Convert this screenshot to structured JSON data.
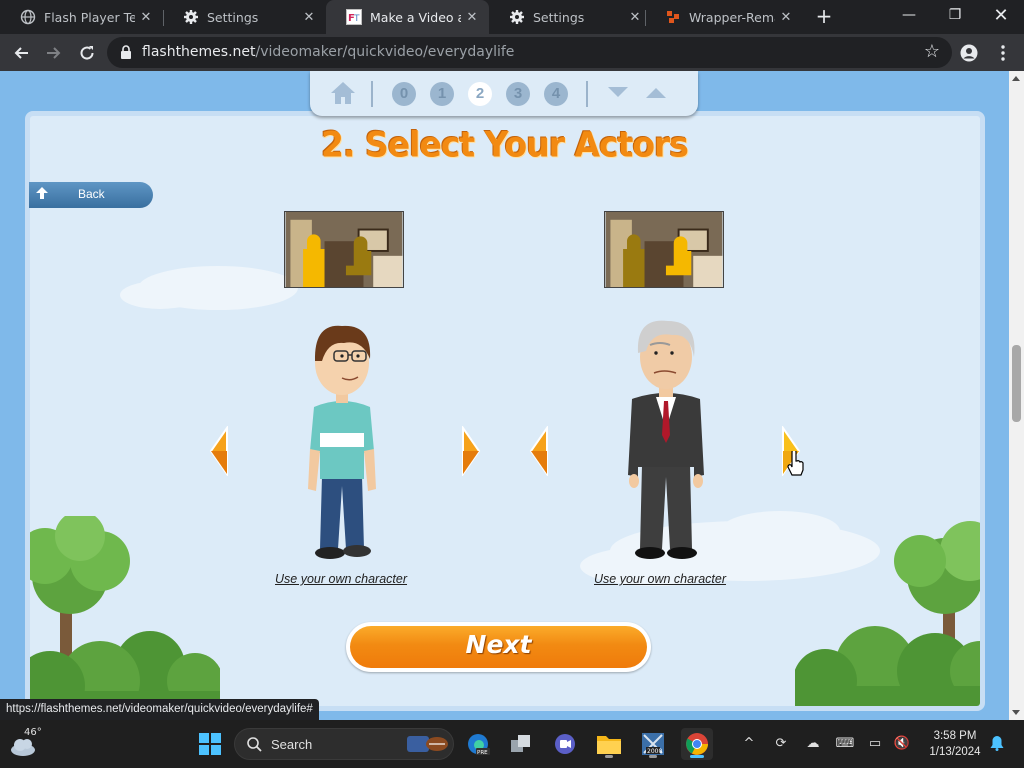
{
  "browser": {
    "tabs": [
      {
        "title": "Flash Player Test",
        "icon": "globe-icon"
      },
      {
        "title": "Settings",
        "icon": "gear-icon"
      },
      {
        "title": "Make a Video abo",
        "icon": "flashthemes-icon",
        "active": true
      },
      {
        "title": "Settings",
        "icon": "gear-icon"
      },
      {
        "title": "Wrapper-Remaste",
        "icon": "wrapper-icon"
      }
    ],
    "url_host": "flashthemes.net",
    "url_path": "/videomaker/quickvideo/everydaylife",
    "status_url": "https://flashthemes.net/videomaker/quickvideo/everydaylife#"
  },
  "steps": {
    "numbers": [
      "0",
      "1",
      "2",
      "3",
      "4"
    ],
    "current_index": 2
  },
  "page": {
    "title": "2. Select Your Actors",
    "back_label": "Back",
    "use_own_left": "Use your own character",
    "use_own_right": "Use your own character",
    "next_label": "Next"
  },
  "taskbar": {
    "temperature": "46°",
    "search_label": "Search",
    "time": "3:58 PM",
    "date": "1/13/2024",
    "pinned": [
      "file-explorer-icon",
      "edge-icon",
      "task-view-icon",
      "teams-chat-icon",
      "folder-icon",
      "wrapper2000-icon",
      "chrome-icon"
    ]
  },
  "colors": {
    "accent_orange": "#f28a12",
    "page_blue": "#7fb9ea",
    "chrome_dark": "#202124"
  }
}
